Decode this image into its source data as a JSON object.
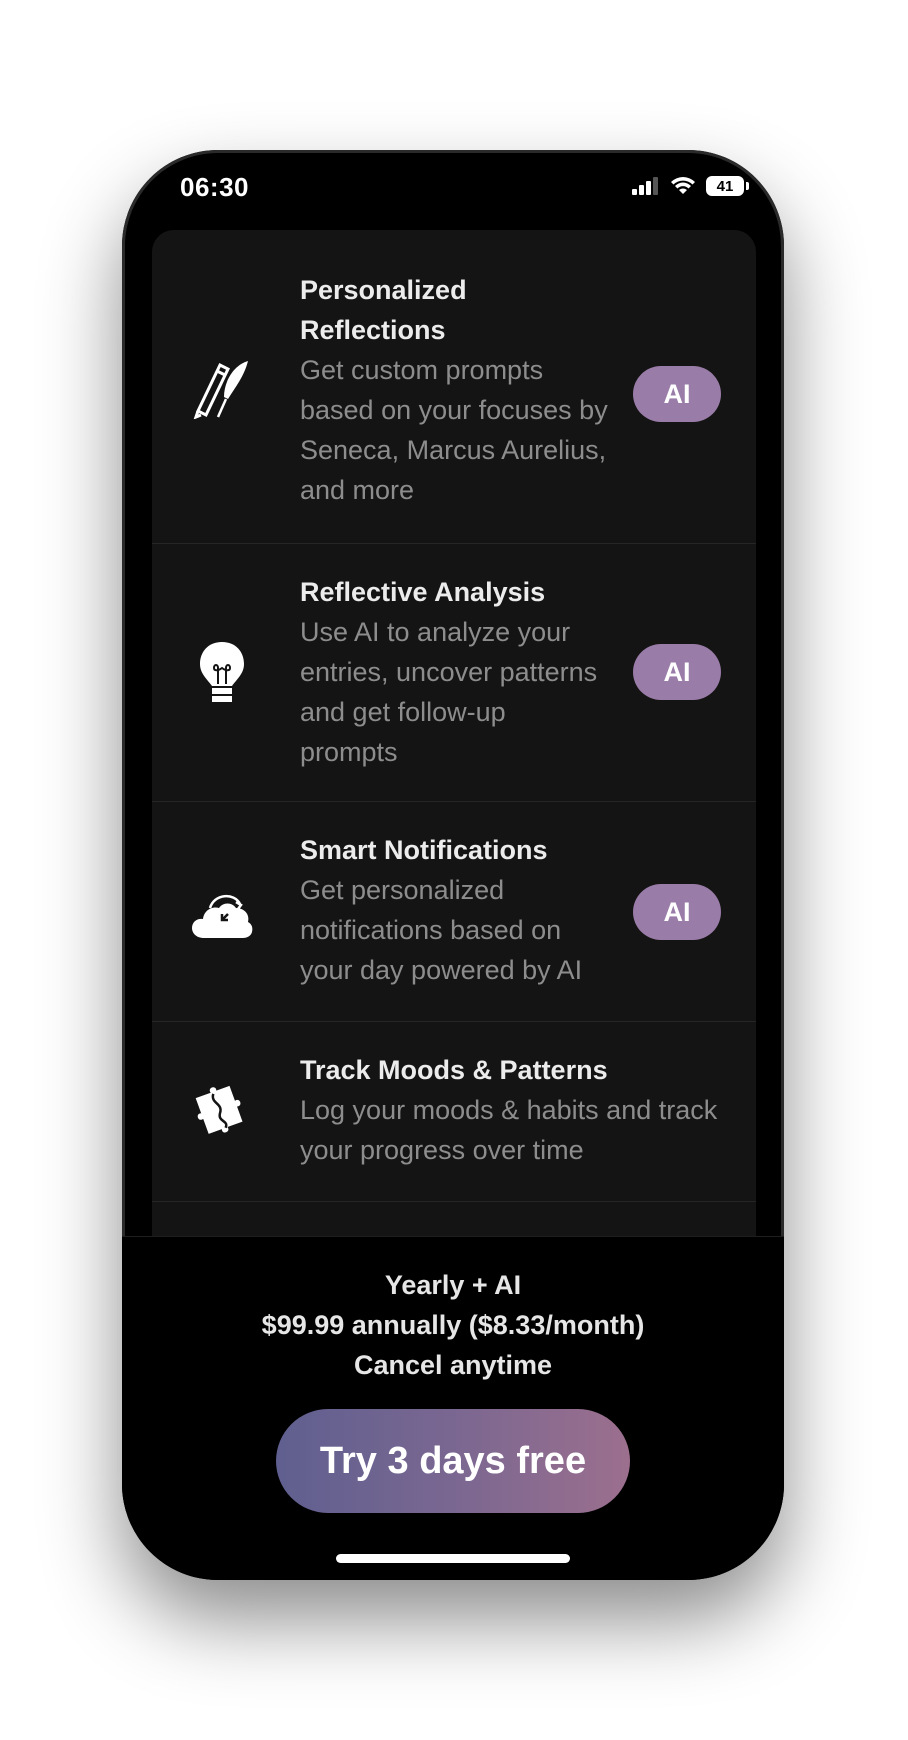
{
  "status_bar": {
    "time": "06:30",
    "battery": "41"
  },
  "features": [
    {
      "icon": "pencil-quill-icon",
      "title": "Personalized Reflections",
      "description": "Get custom prompts based on your focuses by Seneca, Marcus Aurelius, and more",
      "badge": "AI"
    },
    {
      "icon": "lightbulb-icon",
      "title": "Reflective Analysis",
      "description": "Use AI to analyze your entries, uncover patterns and get follow-up prompts",
      "badge": "AI"
    },
    {
      "icon": "cloud-notification-icon",
      "title": "Smart Notifications",
      "description": "Get personalized notifications based on your day powered by AI",
      "badge": "AI"
    },
    {
      "icon": "puzzle-icon",
      "title": "Track Moods & Patterns",
      "description": "Log your moods & habits and track your progress over time",
      "badge": ""
    }
  ],
  "plan": {
    "name": "Yearly + AI",
    "price": "$99.99 annually ($8.33/month)",
    "note": "Cancel anytime"
  },
  "cta": {
    "label": "Try 3 days free"
  },
  "colors": {
    "badge": "#9a7ca8",
    "cta_start": "#5f5f8f",
    "cta_end": "#9c6f8e"
  }
}
